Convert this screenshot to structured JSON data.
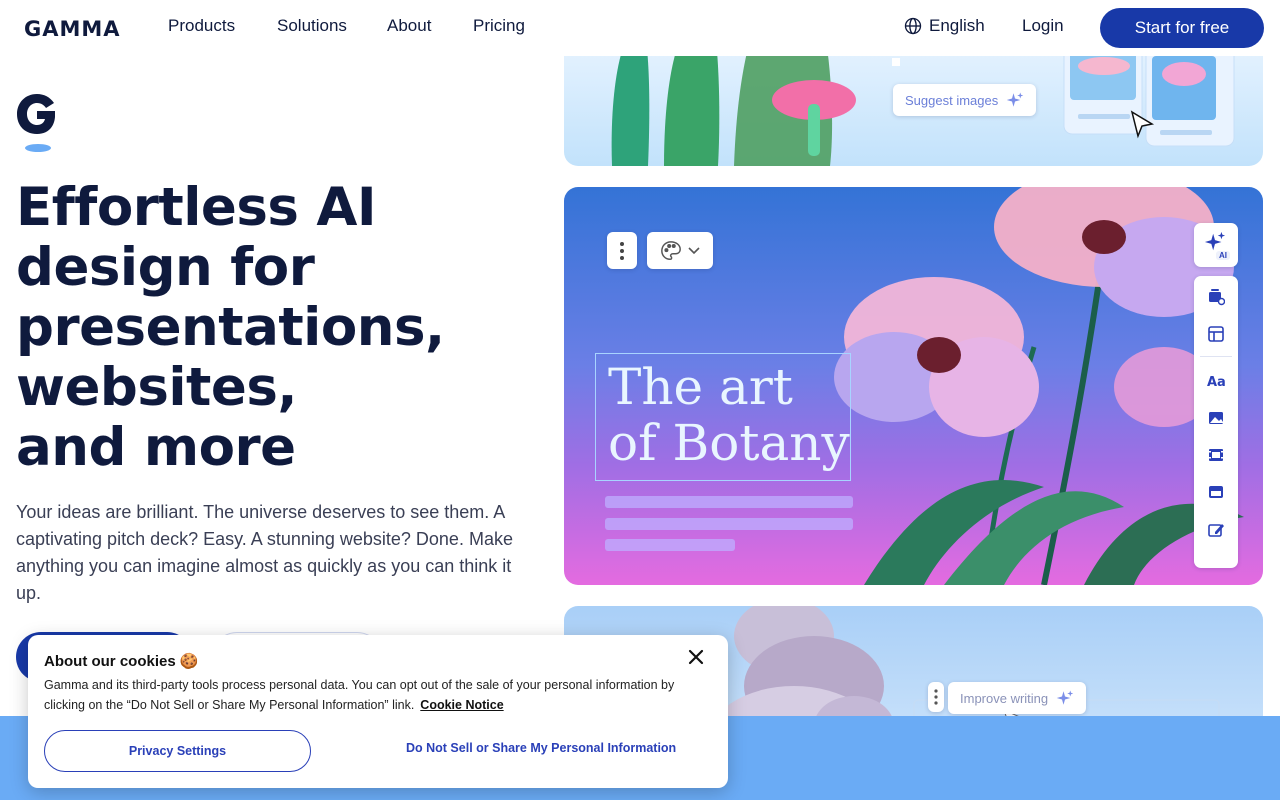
{
  "nav": {
    "logo": "GAMMA",
    "links": [
      "Products",
      "Solutions",
      "About",
      "Pricing"
    ],
    "language": "English",
    "login": "Login",
    "cta": "Start for free"
  },
  "hero": {
    "title_lines": [
      "Effortless AI",
      "design for",
      "presentations,",
      "websites,",
      "and more"
    ],
    "subtitle": "Your ideas are brilliant. The universe deserves to see them. A captivating pitch deck? Easy. A stunning website? Done. Make anything you can imagine almost as quickly as you can think it up."
  },
  "showcase": {
    "suggest_images": "Suggest images",
    "slide_title_lines": [
      "The art",
      "of Botany"
    ],
    "ai_badge": "AI",
    "side_tools": [
      "cards-icon",
      "layout-icon",
      "text-style-icon",
      "image-icon",
      "video-icon",
      "embed-icon",
      "edit-icon"
    ],
    "improve_writing": "Improve writing"
  },
  "cookie": {
    "title": "About our cookies 🍪",
    "body": "Gamma and its third-party tools process personal data. You can opt out of the sale of your personal information by clicking on the “Do Not Sell or Share My Personal Information” link.",
    "notice_link": "Cookie Notice",
    "privacy_button": "Privacy Settings",
    "dns_button": "Do Not Sell or Share My Personal Information"
  },
  "colors": {
    "brand_navy": "#0f1a3d",
    "primary_blue": "#1839a8",
    "accent_light_blue": "#6aabf5"
  }
}
